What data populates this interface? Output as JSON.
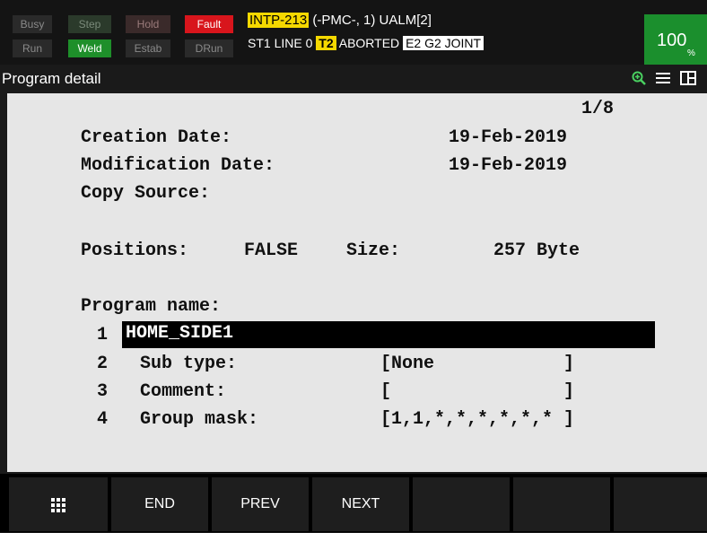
{
  "status": {
    "lamps": {
      "busy": "Busy",
      "step": "Step",
      "hold": "Hold",
      "fault": "Fault",
      "run": "Run",
      "weld": "Weld",
      "estab": "Estab",
      "drun": "DRun"
    },
    "alarm_code": "INTP-213",
    "alarm_text": "(-PMC-, 1) UALM[2]",
    "line_info": "ST1 LINE 0",
    "mode": "T2",
    "state": "ABORTED",
    "group": "E2 G2 JOINT",
    "override_value": "100",
    "override_unit": "%"
  },
  "titlebar": {
    "title": "Program detail"
  },
  "detail": {
    "page": "1/8",
    "creation_label": "Creation Date:",
    "creation_value": "19-Feb-2019",
    "modification_label": "Modification Date:",
    "modification_value": "19-Feb-2019",
    "copy_source_label": "Copy Source:",
    "positions_label": "Positions:",
    "positions_value": "FALSE",
    "size_label": "Size:",
    "size_value": "257 Byte",
    "program_name_label": "Program name:",
    "items": [
      {
        "num": "1",
        "label": "HOME_SIDE1",
        "value": ""
      },
      {
        "num": "2",
        "label": "Sub type:",
        "value": "[None            ]"
      },
      {
        "num": "3",
        "label": "Comment:",
        "value": "[                ]"
      },
      {
        "num": "4",
        "label": "Group mask:",
        "value": "[1,1,*,*,*,*,*,* ]"
      }
    ]
  },
  "function_keys": [
    "",
    "END",
    "PREV",
    "NEXT",
    "",
    "",
    ""
  ]
}
